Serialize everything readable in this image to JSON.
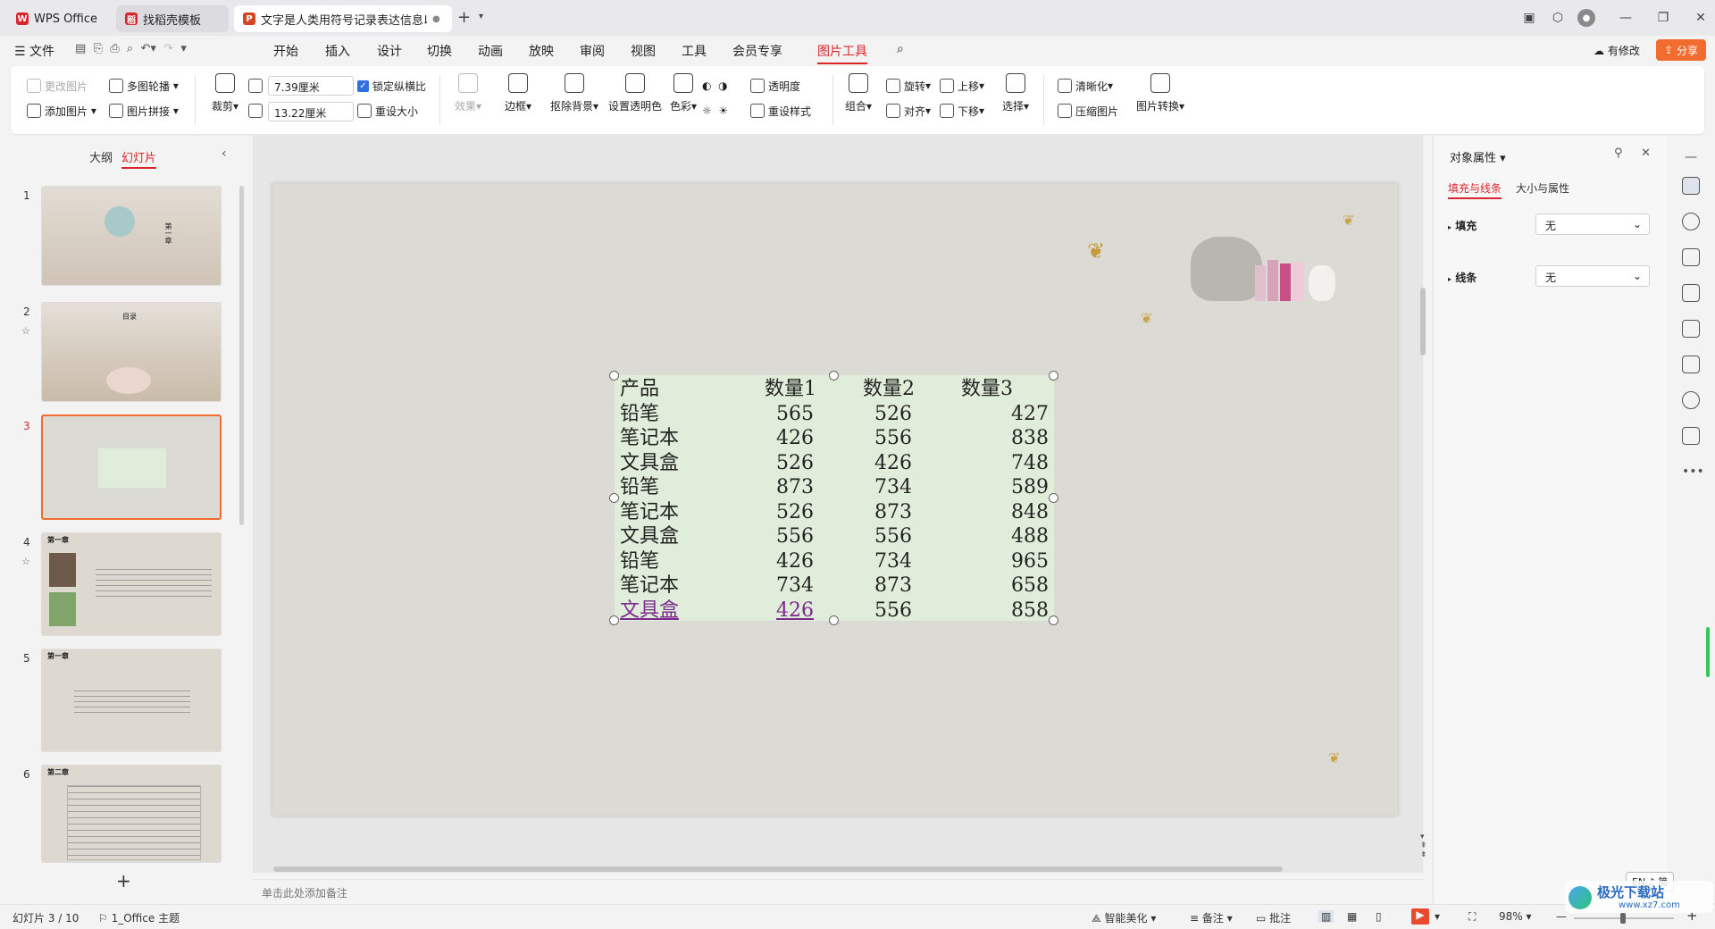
{
  "tabs": [
    {
      "label": "WPS Office",
      "icon": "wps-logo-icon",
      "color": "#d9262c"
    },
    {
      "label": "找稻壳模板",
      "icon": "docer-icon",
      "color": "#d9262c"
    },
    {
      "label": "文字是人类用符号记录表达信息以",
      "icon": "ppt-icon",
      "color": "#d24625"
    }
  ],
  "menubar": {
    "file": "文件",
    "items": [
      "开始",
      "插入",
      "设计",
      "切换",
      "动画",
      "放映",
      "审阅",
      "视图",
      "工具",
      "会员专享",
      "图片工具"
    ],
    "active": "图片工具",
    "has_changes": "有修改",
    "share": "分享"
  },
  "ribbon": {
    "change_pic": "更改图片",
    "multi_carousel": "多图轮播",
    "add_pic": "添加图片",
    "pic_collage": "图片拼接",
    "crop": "裁剪",
    "width": "7.39厘米",
    "height": "13.22厘米",
    "lock_ratio": "锁定纵横比",
    "reset_size": "重设大小",
    "effects": "效果",
    "border": "边框",
    "cutout": "抠除背景",
    "set_transparent": "设置透明色",
    "color": "色彩",
    "transparency": "透明度",
    "reset_style": "重设样式",
    "rotate": "旋转",
    "bring_up": "上移",
    "group": "组合",
    "align": "对齐",
    "send_down": "下移",
    "select": "选择",
    "sharpen": "清晰化",
    "compress": "压缩图片",
    "convert": "图片转换"
  },
  "leftpane": {
    "tab_outline": "大纲",
    "tab_slides": "幻灯片",
    "thumbs": [
      {
        "num": "1",
        "title": "第一章"
      },
      {
        "num": "2",
        "title": "目录"
      },
      {
        "num": "3",
        "title": ""
      },
      {
        "num": "4",
        "title": "第一章"
      },
      {
        "num": "5",
        "title": "第一章"
      },
      {
        "num": "6",
        "title": "第二章"
      }
    ],
    "add": "+"
  },
  "table": {
    "header": [
      "产品",
      "数量1",
      "数量2",
      "数量3"
    ],
    "rows": [
      [
        "铅笔",
        "565",
        "526",
        "427"
      ],
      [
        "笔记本",
        "426",
        "556",
        "838"
      ],
      [
        "文具盒",
        "526",
        "426",
        "748"
      ],
      [
        "铅笔",
        "873",
        "734",
        "589"
      ],
      [
        "笔记本",
        "526",
        "873",
        "848"
      ],
      [
        "文具盒",
        "556",
        "556",
        "488"
      ],
      [
        "铅笔",
        "426",
        "734",
        "965"
      ],
      [
        "笔记本",
        "734",
        "873",
        "658"
      ],
      [
        "文具盒",
        "426",
        "556",
        "858"
      ]
    ]
  },
  "notes_placeholder": "单击此处添加备注",
  "rightpane": {
    "title": "对象属性",
    "tab_fill": "填充与线条",
    "tab_size": "大小与属性",
    "fill_label": "填充",
    "fill_value": "无",
    "line_label": "线条",
    "line_value": "无"
  },
  "ime": "EN ♪ 简",
  "statusbar": {
    "slide_info": "幻灯片 3 / 10",
    "theme": "1_Office 主题",
    "beautify": "智能美化",
    "notes": "备注",
    "comments": "批注",
    "zoom": "98%"
  },
  "watermark": "极光下载站",
  "watermark_url": "www.xz7.com"
}
